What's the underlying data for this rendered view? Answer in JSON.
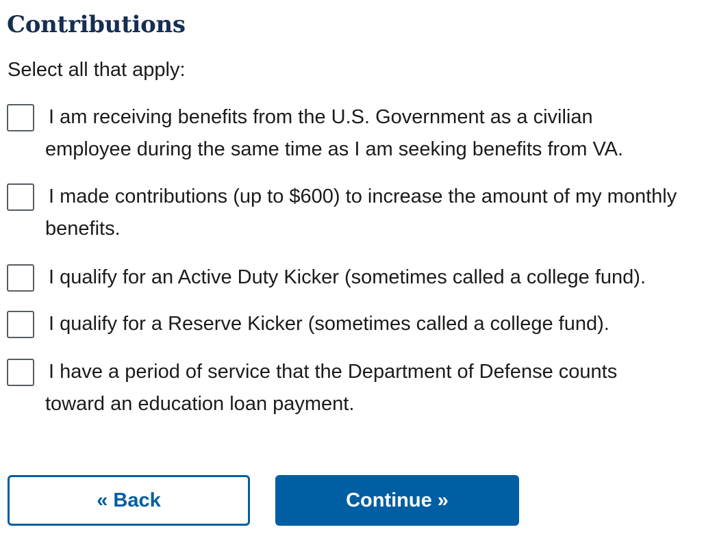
{
  "section": {
    "title": "Contributions",
    "instructions": "Select all that apply:"
  },
  "options": [
    {
      "label": "I am receiving benefits from the U.S. Government as a civilian employee during the same time as I am seeking benefits from VA.",
      "checked": false
    },
    {
      "label": "I made contributions (up to $600) to increase the amount of my monthly benefits.",
      "checked": false
    },
    {
      "label": "I qualify for an Active Duty Kicker (sometimes called a college fund).",
      "checked": false
    },
    {
      "label": "I qualify for a Reserve Kicker (sometimes called a college fund).",
      "checked": false
    },
    {
      "label": "I have a period of service that the Department of Defense counts toward an education loan payment.",
      "checked": false
    }
  ],
  "navigation": {
    "back_label": "« Back",
    "continue_label": "Continue »"
  },
  "colors": {
    "heading": "#162e51",
    "primary": "#005ea2",
    "checkbox_border": "#565c65"
  }
}
